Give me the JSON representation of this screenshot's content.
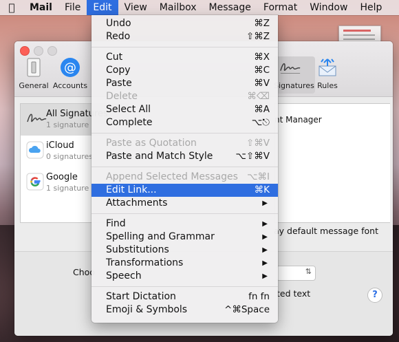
{
  "menubar": {
    "apple_icon": "apple-logo-icon",
    "items": [
      {
        "label": "Mail",
        "bold": true,
        "active": false
      },
      {
        "label": "File",
        "bold": false,
        "active": false
      },
      {
        "label": "Edit",
        "bold": false,
        "active": true
      },
      {
        "label": "View",
        "bold": false,
        "active": false
      },
      {
        "label": "Mailbox",
        "bold": false,
        "active": false
      },
      {
        "label": "Message",
        "bold": false,
        "active": false
      },
      {
        "label": "Format",
        "bold": false,
        "active": false
      },
      {
        "label": "Window",
        "bold": false,
        "active": false
      },
      {
        "label": "Help",
        "bold": false,
        "active": false
      }
    ]
  },
  "window": {
    "toolbar": {
      "general_label": "General",
      "accounts_label": "Accounts",
      "signatures_label": "Signatures",
      "rules_label": "Rules"
    },
    "accounts": [
      {
        "name": "All Signatures",
        "count": "1 signature",
        "icon": "signature-icon"
      },
      {
        "name": "iCloud",
        "count": "0 signatures",
        "icon": "icloud-icon"
      },
      {
        "name": "Google",
        "count": "1 signature",
        "icon": "google-icon"
      }
    ],
    "signature_text": "nt Manager",
    "default_font_text": "ay default message font",
    "choose_label": "Choo",
    "quoted_text_label": "ted text",
    "help_label": "?"
  },
  "edit_menu": {
    "groups": [
      [
        {
          "label": "Undo",
          "shortcut": "⌘Z",
          "disabled": false
        },
        {
          "label": "Redo",
          "shortcut": "⇧⌘Z",
          "disabled": false
        }
      ],
      [
        {
          "label": "Cut",
          "shortcut": "⌘X",
          "disabled": false
        },
        {
          "label": "Copy",
          "shortcut": "⌘C",
          "disabled": false
        },
        {
          "label": "Paste",
          "shortcut": "⌘V",
          "disabled": false
        },
        {
          "label": "Delete",
          "shortcut": "⌘⌫",
          "disabled": true
        },
        {
          "label": "Select All",
          "shortcut": "⌘A",
          "disabled": false
        },
        {
          "label": "Complete",
          "shortcut": "⌥⎋",
          "disabled": false
        }
      ],
      [
        {
          "label": "Paste as Quotation",
          "shortcut": "⇧⌘V",
          "disabled": true
        },
        {
          "label": "Paste and Match Style",
          "shortcut": "⌥⇧⌘V",
          "disabled": false
        }
      ],
      [
        {
          "label": "Append Selected Messages",
          "shortcut": "⌥⌘I",
          "disabled": true
        },
        {
          "label": "Edit Link...",
          "shortcut": "⌘K",
          "disabled": false,
          "highlighted": true
        },
        {
          "label": "Attachments",
          "submenu": true,
          "disabled": false
        }
      ],
      [
        {
          "label": "Find",
          "submenu": true,
          "disabled": false
        },
        {
          "label": "Spelling and Grammar",
          "submenu": true,
          "disabled": false
        },
        {
          "label": "Substitutions",
          "submenu": true,
          "disabled": false
        },
        {
          "label": "Transformations",
          "submenu": true,
          "disabled": false
        },
        {
          "label": "Speech",
          "submenu": true,
          "disabled": false
        }
      ],
      [
        {
          "label": "Start Dictation",
          "shortcut": "fn fn",
          "disabled": false
        },
        {
          "label": "Emoji & Symbols",
          "shortcut": "^⌘Space",
          "disabled": false
        }
      ]
    ]
  },
  "colors": {
    "highlight": "#2f6ee0",
    "disabled_text": "#a9a9a9"
  }
}
